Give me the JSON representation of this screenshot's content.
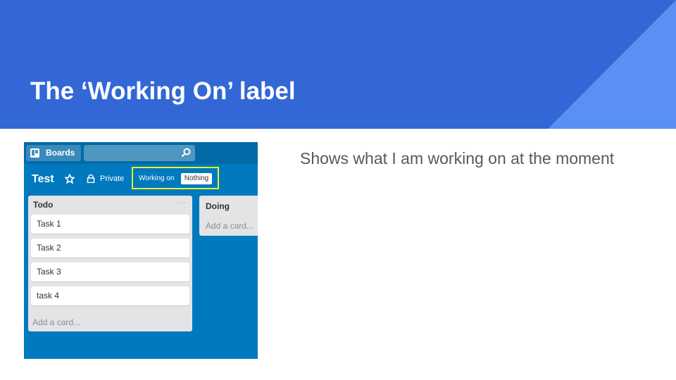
{
  "slide": {
    "title": "The ‘Working On’ label",
    "body": "Shows what I am working on at the moment",
    "colors": {
      "header": "#3367d6",
      "triangle": "#5a8ff4",
      "title": "#ffffff",
      "body": "#595959"
    }
  },
  "trello": {
    "boards_label": "Boards",
    "board_name": "Test",
    "visibility_label": "Private",
    "working_on_label": "Working on",
    "working_on_value": "Nothing",
    "lists": [
      {
        "title": "Todo",
        "cards": [
          "Task 1",
          "Task 2",
          "Task 3",
          "task 4"
        ],
        "add_card": "Add a card..."
      },
      {
        "title": "Doing",
        "cards": [],
        "add_card": "Add a card..."
      }
    ],
    "icons": [
      "boards-icon",
      "search-icon",
      "star-icon",
      "lock-icon",
      "list-menu-icon"
    ],
    "colors": {
      "board_bg": "#0079bf",
      "topbar": "#026aa7",
      "highlight_border": "#e6f229",
      "list_bg": "#e2e4e6"
    }
  }
}
